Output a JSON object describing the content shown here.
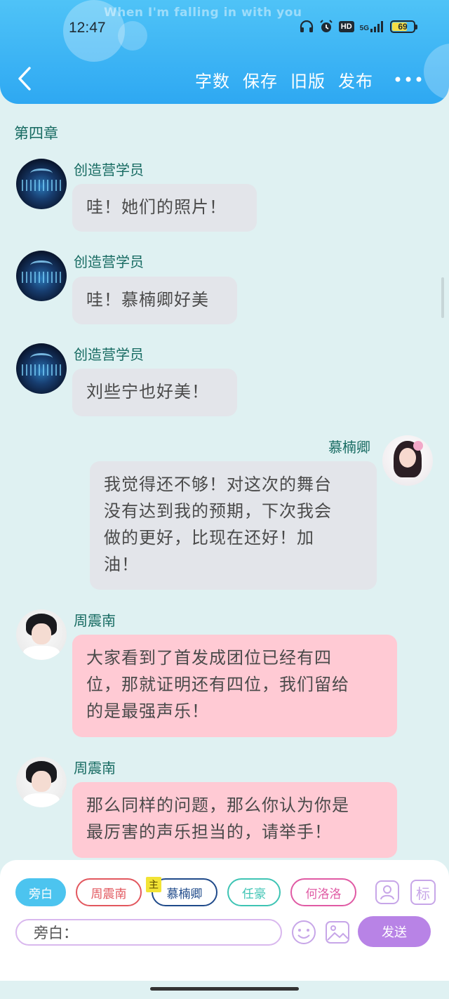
{
  "status_bar": {
    "time": "12:47",
    "lyric": "When I'm falling in with you",
    "network": "5G",
    "hd_badge": "HD",
    "battery": "69"
  },
  "toolbar": {
    "back_icon": "chevron-left-icon",
    "word_count": "字数",
    "save": "保存",
    "old_version": "旧版",
    "publish": "发布",
    "more_icon": "more-horizontal-icon"
  },
  "chapter": "第四章",
  "messages": [
    {
      "sender": "创造营学员",
      "side": "left",
      "text": "哇！她们的照片！",
      "bubble": "gray"
    },
    {
      "sender": "创造营学员",
      "side": "left",
      "text": "哇！慕楠卿好美",
      "bubble": "gray"
    },
    {
      "sender": "创造营学员",
      "side": "left",
      "text": "刘些宁也好美！",
      "bubble": "gray"
    },
    {
      "sender": "慕楠卿",
      "side": "right",
      "lines": [
        "我觉得还不够！对这次的舞台",
        "没有达到我的预期，下次我会",
        "做的更好，比现在还好！加",
        "油！"
      ],
      "bubble": "gray"
    },
    {
      "sender": "周震南",
      "side": "left",
      "lines": [
        "大家看到了首发成团位已经有四",
        "位，那就证明还有四位，我们留给",
        "的是最强声乐！"
      ],
      "bubble": "pink"
    },
    {
      "sender": "周震南",
      "side": "left",
      "lines": [
        "那么同样的问题，那么你认为你是",
        "最厉害的声乐担当的，请举手！"
      ],
      "bubble": "pink"
    }
  ],
  "roles": {
    "narration": "旁白",
    "r1": "周震南",
    "r2": "慕楠卿",
    "r2_tag": "主",
    "r3": "任豪",
    "r4": "何洛洛"
  },
  "role_colors": {
    "narration": "#4cc4ef",
    "r1": "#e2575e",
    "r2": "#1f4a8a",
    "r3": "#3ec4b4",
    "r4": "#e05aa4"
  },
  "composer": {
    "value": "旁白：",
    "send": "发送",
    "icons": [
      "user-card-icon",
      "tag-icon",
      "emoji-icon",
      "image-icon"
    ],
    "tag_label": "标"
  }
}
